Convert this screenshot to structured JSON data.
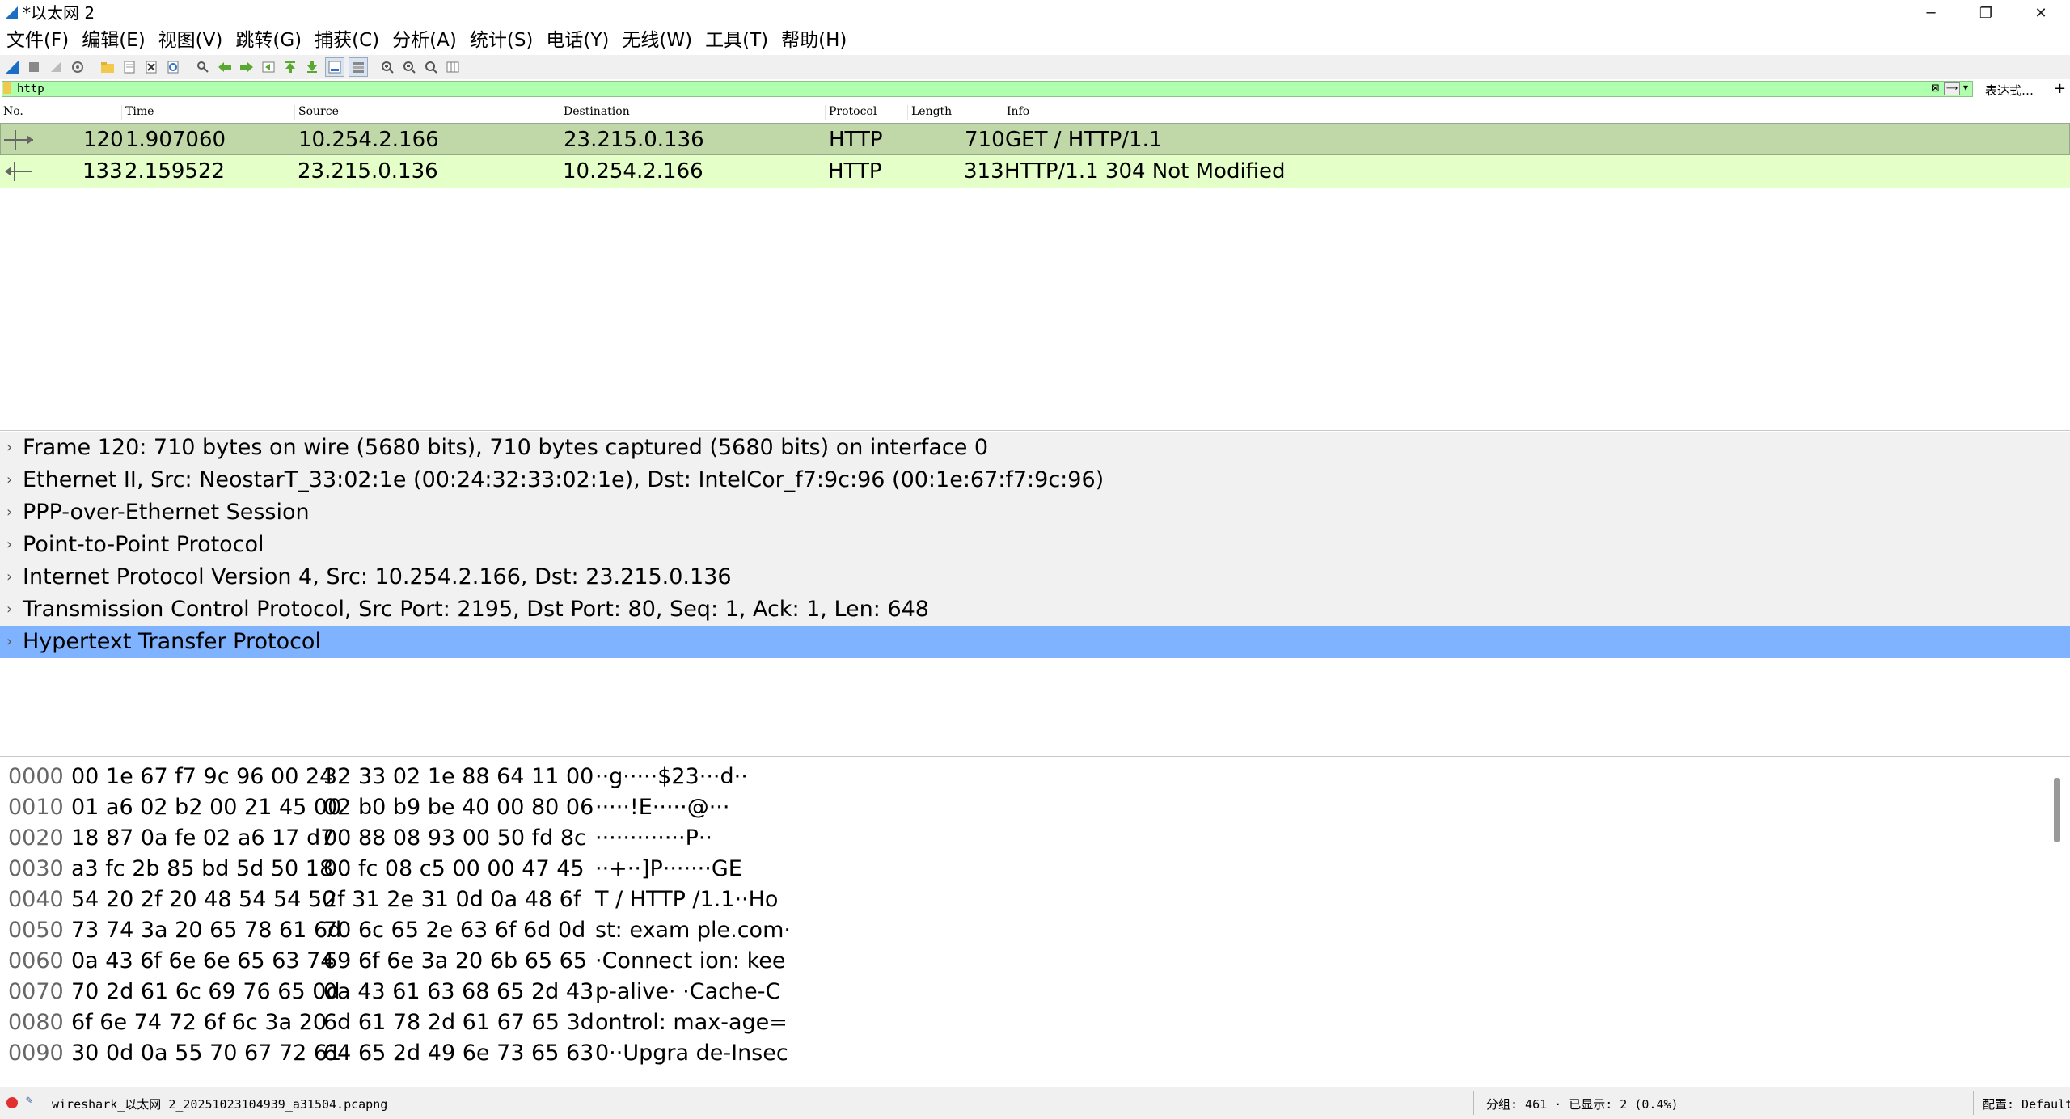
{
  "window": {
    "title": "*以太网 2",
    "minimize": "─",
    "restore": "❐",
    "close": "✕"
  },
  "menu": [
    "文件(F)",
    "编辑(E)",
    "视图(V)",
    "跳转(G)",
    "捕获(C)",
    "分析(A)",
    "统计(S)",
    "电话(Y)",
    "无线(W)",
    "工具(T)",
    "帮助(H)"
  ],
  "toolbar_icons": [
    "shark-fin-icon",
    "stop-icon",
    "restart-icon",
    "options-icon",
    "open-icon",
    "save-icon",
    "close-file-icon",
    "reload-icon",
    "find-icon",
    "back-icon",
    "forward-icon",
    "goto-icon",
    "first-icon",
    "last-icon",
    "autoscroll-icon",
    "colorize-icon",
    "zoom-in-icon",
    "zoom-out-icon",
    "zoom-reset-icon",
    "resize-columns-icon"
  ],
  "filter": {
    "value": "http",
    "expression_label": "表达式…",
    "plus": "+"
  },
  "packet_list": {
    "columns": [
      "No.",
      "Time",
      "Source",
      "Destination",
      "Protocol",
      "Length",
      "Info"
    ],
    "rows": [
      {
        "no": "120",
        "time": "1.907060",
        "source": "10.254.2.166",
        "destination": "23.215.0.136",
        "protocol": "HTTP",
        "length": "710",
        "info": "GET / HTTP/1.1",
        "bg": "#c0d8a8"
      },
      {
        "no": "133",
        "time": "2.159522",
        "source": "23.215.0.136",
        "destination": "10.254.2.166",
        "protocol": "HTTP",
        "length": "313",
        "info": "HTTP/1.1 304 Not Modified",
        "bg": "#e4ffc7"
      }
    ]
  },
  "details": [
    "Frame 120: 710 bytes on wire (5680 bits), 710 bytes captured (5680 bits) on interface 0",
    "Ethernet II, Src: NeostarT_33:02:1e (00:24:32:33:02:1e), Dst: IntelCor_f7:9c:96 (00:1e:67:f7:9c:96)",
    "PPP-over-Ethernet Session",
    "Point-to-Point Protocol",
    "Internet Protocol Version 4, Src: 10.254.2.166, Dst: 23.215.0.136",
    "Transmission Control Protocol, Src Port: 2195, Dst Port: 80, Seq: 1, Ack: 1, Len: 648",
    "Hypertext Transfer Protocol"
  ],
  "bytes": [
    {
      "offset": "0000",
      "hex1": "00 1e 67 f7 9c 96 00 24",
      "hex2": "32 33 02 1e 88 64 11 00",
      "ascii": "··g·····$23···d··"
    },
    {
      "offset": "0010",
      "hex1": "01 a6 02 b2 00 21 45 00",
      "hex2": "02 b0 b9 be 40 00 80 06",
      "ascii": "·····!E·····@···"
    },
    {
      "offset": "0020",
      "hex1": "18 87 0a fe 02 a6 17 d7",
      "hex2": "00 88 08 93 00 50 fd 8c",
      "ascii": "·············P··"
    },
    {
      "offset": "0030",
      "hex1": "a3 fc 2b 85 bd 5d 50 18",
      "hex2": "00 fc 08 c5 00 00 47 45",
      "ascii": "··+··]P·······GE"
    },
    {
      "offset": "0040",
      "hex1": "54 20 2f 20 48 54 54 50",
      "hex2": "2f 31 2e 31 0d 0a 48 6f",
      "ascii": "T / HTTP /1.1··Ho"
    },
    {
      "offset": "0050",
      "hex1": "73 74 3a 20 65 78 61 6d",
      "hex2": "70 6c 65 2e 63 6f 6d 0d",
      "ascii": "st: exam ple.com·"
    },
    {
      "offset": "0060",
      "hex1": "0a 43 6f 6e 6e 65 63 74",
      "hex2": "69 6f 6e 3a 20 6b 65 65",
      "ascii": "·Connect ion: kee"
    },
    {
      "offset": "0070",
      "hex1": "70 2d 61 6c 69 76 65 0d",
      "hex2": "0a 43 61 63 68 65 2d 43",
      "ascii": "p-alive· ·Cache-C"
    },
    {
      "offset": "0080",
      "hex1": "6f 6e 74 72 6f 6c 3a 20",
      "hex2": "6d 61 78 2d 61 67 65 3d",
      "ascii": "ontrol:  max-age="
    },
    {
      "offset": "0090",
      "hex1": "30 0d 0a 55 70 67 72 61",
      "hex2": "64 65 2d 49 6e 73 65 63",
      "ascii": "0··Upgra de-Insec"
    }
  ],
  "status": {
    "file": "wireshark_以太网 2_20251023104939_a31504.pcapng",
    "packets": "分组: 461 · 已显示: 2 (0.4%)",
    "profile": "配置: Default"
  }
}
